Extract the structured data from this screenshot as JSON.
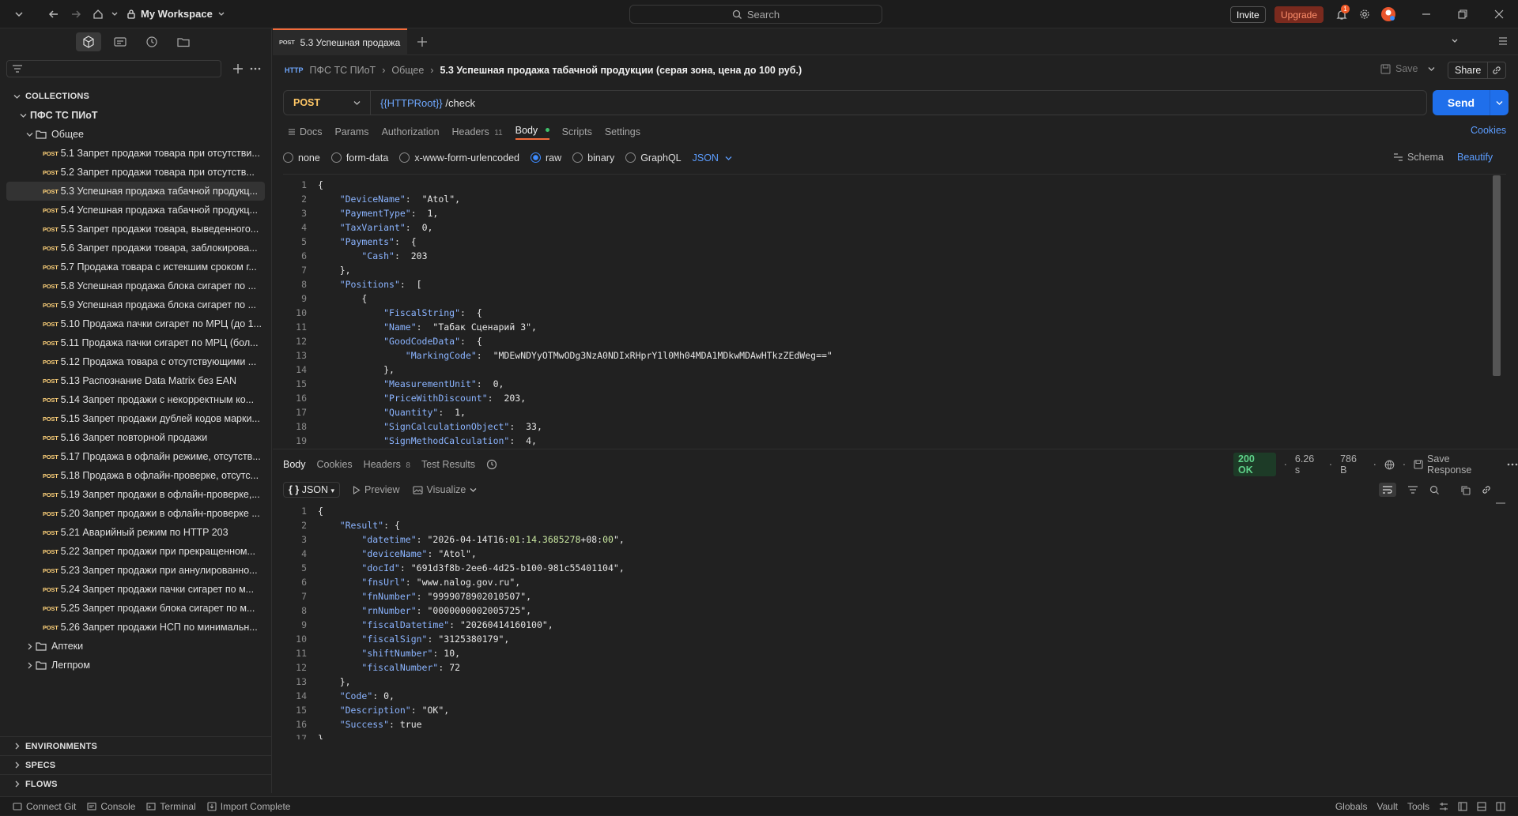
{
  "titlebar": {
    "workspace": "My Workspace",
    "search_placeholder": "Search",
    "invite": "Invite",
    "upgrade": "Upgrade",
    "notification_count": "1"
  },
  "sidebar": {
    "collections_label": "COLLECTIONS",
    "collection_name": "ПФС ТС ПИоТ",
    "folder_general": "Общее",
    "requests": [
      {
        "method": "POST",
        "label": "5.1 Запрет продажи товара при отсутстви..."
      },
      {
        "method": "POST",
        "label": "5.2 Запрет продажи товара при отсутств..."
      },
      {
        "method": "POST",
        "label": "5.3 Успешная продажа табачной продукц..."
      },
      {
        "method": "POST",
        "label": "5.4 Успешная продажа табачной продукц..."
      },
      {
        "method": "POST",
        "label": "5.5 Запрет продажи товара, выведенного..."
      },
      {
        "method": "POST",
        "label": "5.6 Запрет продажи товара, заблокирова..."
      },
      {
        "method": "POST",
        "label": "5.7 Продажа товара с истекшим сроком г..."
      },
      {
        "method": "POST",
        "label": "5.8 Успешная продажа блока сигарет по ..."
      },
      {
        "method": "POST",
        "label": "5.9 Успешная продажа блока сигарет по ..."
      },
      {
        "method": "POST",
        "label": "5.10 Продажа пачки сигарет по МРЦ (до 1..."
      },
      {
        "method": "POST",
        "label": "5.11 Продажа пачки сигарет по МРЦ (бол..."
      },
      {
        "method": "POST",
        "label": "5.12 Продажа товара с отсутствующими ..."
      },
      {
        "method": "POST",
        "label": "5.13 Распознание Data Matrix без EAN"
      },
      {
        "method": "POST",
        "label": "5.14 Запрет продажи с некорректным ко..."
      },
      {
        "method": "POST",
        "label": "5.15 Запрет продажи дублей кодов марки..."
      },
      {
        "method": "POST",
        "label": "5.16 Запрет повторной продажи"
      },
      {
        "method": "POST",
        "label": "5.17 Продажа в офлайн режиме, отсутств..."
      },
      {
        "method": "POST",
        "label": "5.18 Продажа в офлайн-проверке, отсутс..."
      },
      {
        "method": "POST",
        "label": "5.19 Запрет продажи в офлайн-проверке,..."
      },
      {
        "method": "POST",
        "label": "5.20 Запрет продажи в офлайн-проверке ..."
      },
      {
        "method": "POST",
        "label": "5.21 Аварийный режим по HTTP 203"
      },
      {
        "method": "POST",
        "label": "5.22 Запрет продажи при прекращенном..."
      },
      {
        "method": "POST",
        "label": "5.23 Запрет продажи при аннулированно..."
      },
      {
        "method": "POST",
        "label": "5.24 Запрет продажи пачки сигарет по м..."
      },
      {
        "method": "POST",
        "label": "5.25 Запрет продажи блока сигарет по м..."
      },
      {
        "method": "POST",
        "label": "5.26 Запрет продажи НСП по минимальн..."
      }
    ],
    "folders": [
      "Аптеки",
      "Легпром"
    ],
    "sections": [
      "ENVIRONMENTS",
      "SPECS",
      "FLOWS"
    ]
  },
  "tab": {
    "method": "POST",
    "title": "5.3 Успешная продажа"
  },
  "request": {
    "breadcrumb": [
      "ПФС ТС ПИоТ",
      "Общее"
    ],
    "title": "5.3 Успешная продажа табачной продукции (серая зона, цена до 100 руб.)",
    "save": "Save",
    "share": "Share",
    "method": "POST",
    "url_var": "{{HTTPRoot}}",
    "url_path": " /check",
    "send": "Send",
    "tabs": [
      "Docs",
      "Params",
      "Authorization",
      "Headers",
      "Body",
      "Scripts",
      "Settings"
    ],
    "headers_count": "11",
    "cookies": "Cookies",
    "body_types": [
      "none",
      "form-data",
      "x-www-form-urlencoded",
      "raw",
      "binary",
      "GraphQL"
    ],
    "body_format": "JSON",
    "schema": "Schema",
    "beautify": "Beautify"
  },
  "request_body": [
    "{",
    "    \"DeviceName\":  \"Atol\",",
    "    \"PaymentType\":  1,",
    "    \"TaxVariant\":  0,",
    "    \"Payments\":  {",
    "        \"Cash\":  203",
    "    },",
    "    \"Positions\":  [",
    "        {",
    "            \"FiscalString\":  {",
    "            \"Name\":  \"Табак Сценарий 3\",",
    "            \"GoodCodeData\":  {",
    "                \"MarkingCode\":  \"MDEwNDYyOTMwODg3NzA0NDIxRHprY1l0Mh04MDA1MDkwMDAwHTkzZEdWeg==\"",
    "            },",
    "            \"MeasurementUnit\":  0,",
    "            \"PriceWithDiscount\":  203,",
    "            \"Quantity\":  1,",
    "            \"SignCalculationObject\":  33,",
    "            \"SignMethodCalculation\":  4,"
  ],
  "response": {
    "tabs": [
      "Body",
      "Cookies",
      "Headers",
      "Test Results"
    ],
    "headers_count": "8",
    "status": "200 OK",
    "time": "6.26 s",
    "size": "786 B",
    "save_response": "Save Response",
    "format": "JSON",
    "preview": "Preview",
    "visualize": "Visualize"
  },
  "response_body": [
    "{",
    "    \"Result\": {",
    "        \"datetime\": \"2026-04-14T16:01:14.3685278+08:00\",",
    "        \"deviceName\": \"Atol\",",
    "        \"docId\": \"691d3f8b-2ee6-4d25-b100-981c55401104\",",
    "        \"fnsUrl\": \"www.nalog.gov.ru\",",
    "        \"fnNumber\": \"9999078902010507\",",
    "        \"rnNumber\": \"0000000002005725\",",
    "        \"fiscalDatetime\": \"20260414160100\",",
    "        \"fiscalSign\": \"3125380179\",",
    "        \"shiftNumber\": 10,",
    "        \"fiscalNumber\": 72",
    "    },",
    "    \"Code\": 0,",
    "    \"Description\": \"OK\",",
    "    \"Success\": true",
    "}"
  ],
  "statusbar": {
    "connect_git": "Connect Git",
    "console": "Console",
    "terminal": "Terminal",
    "import_complete": "Import Complete",
    "globals": "Globals",
    "vault": "Vault",
    "tools": "Tools"
  }
}
